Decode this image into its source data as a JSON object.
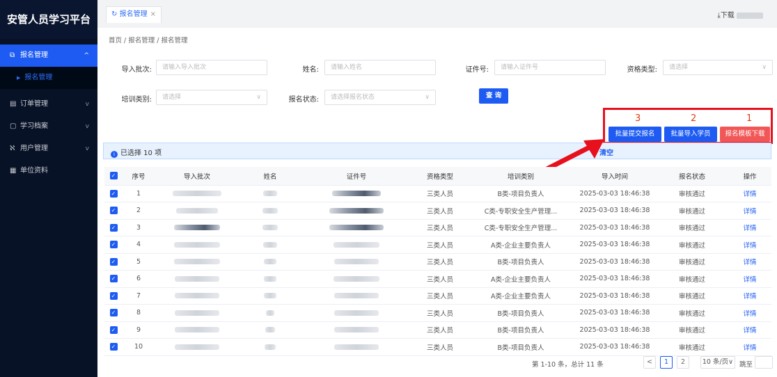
{
  "app_title": "安管人员学习平台",
  "sidebar": {
    "items": [
      {
        "label": "报名管理",
        "icon": "signup-icon",
        "chevron": "^"
      },
      {
        "label": "报名管理"
      },
      {
        "label": "订单管理",
        "icon": "order-icon",
        "chevron": "v"
      },
      {
        "label": "学习档案",
        "icon": "archive-icon",
        "chevron": "v"
      },
      {
        "label": "用户管理",
        "icon": "user-icon",
        "chevron": "v"
      },
      {
        "label": "单位资料",
        "icon": "unit-icon"
      }
    ]
  },
  "tab": {
    "label": "报名管理",
    "close": "×"
  },
  "download_label": "下载",
  "breadcrumb": "首页 / 报名管理 / 报名管理",
  "filters": {
    "batch_label": "导入批次:",
    "batch_placeholder": "请输入导入批次",
    "name_label": "姓名:",
    "name_placeholder": "请输入姓名",
    "id_label": "证件号:",
    "id_placeholder": "请输入证件号",
    "qual_label": "资格类型:",
    "qual_placeholder": "请选择",
    "train_label": "培训类别:",
    "train_placeholder": "请选择",
    "status_label": "报名状态:",
    "status_placeholder": "请选择报名状态",
    "query": "查 询"
  },
  "actions": {
    "batch_submit": "批量提交报名",
    "batch_import": "批量导入学员",
    "template_download": "报名模板下载",
    "num_submit": "3",
    "num_import": "2",
    "num_template": "1"
  },
  "selection": {
    "info": "已选择 10 项",
    "clear": "清空"
  },
  "table": {
    "headers": [
      "序号",
      "导入批次",
      "姓名",
      "证件号",
      "资格类型",
      "培训类别",
      "导入时间",
      "报名状态",
      "操作"
    ],
    "rows": [
      {
        "no": "1",
        "qual": "三类人员",
        "train": "B类-项目负责人",
        "time": "2025-03-03 18:46:38",
        "status": "审核通过",
        "op": "详情"
      },
      {
        "no": "2",
        "qual": "三类人员",
        "train": "C类-专职安全生产管理...",
        "time": "2025-03-03 18:46:38",
        "status": "审核通过",
        "op": "详情"
      },
      {
        "no": "3",
        "qual": "三类人员",
        "train": "C类-专职安全生产管理...",
        "time": "2025-03-03 18:46:38",
        "status": "审核通过",
        "op": "详情"
      },
      {
        "no": "4",
        "qual": "三类人员",
        "train": "A类-企业主要负责人",
        "time": "2025-03-03 18:46:38",
        "status": "审核通过",
        "op": "详情"
      },
      {
        "no": "5",
        "qual": "三类人员",
        "train": "B类-项目负责人",
        "time": "2025-03-03 18:46:38",
        "status": "审核通过",
        "op": "详情"
      },
      {
        "no": "6",
        "qual": "三类人员",
        "train": "A类-企业主要负责人",
        "time": "2025-03-03 18:46:38",
        "status": "审核通过",
        "op": "详情"
      },
      {
        "no": "7",
        "qual": "三类人员",
        "train": "A类-企业主要负责人",
        "time": "2025-03-03 18:46:38",
        "status": "审核通过",
        "op": "详情"
      },
      {
        "no": "8",
        "qual": "三类人员",
        "train": "B类-项目负责人",
        "time": "2025-03-03 18:46:38",
        "status": "审核通过",
        "op": "详情"
      },
      {
        "no": "9",
        "qual": "三类人员",
        "train": "B类-项目负责人",
        "time": "2025-03-03 18:46:38",
        "status": "审核通过",
        "op": "详情"
      },
      {
        "no": "10",
        "qual": "三类人员",
        "train": "B类-项目负责人",
        "time": "2025-03-03 18:46:38",
        "status": "审核通过",
        "op": "详情"
      }
    ]
  },
  "pagination": {
    "total_text": "第 1-10 条，总计 11 条",
    "prev": "<",
    "next": ">",
    "page1": "1",
    "page2": "2",
    "page_size": "10 条/页∨",
    "jump_label": "跳至"
  },
  "colors": {
    "primary": "#1d5bf2",
    "danger": "#f25757",
    "highlight": "#e8101d",
    "sidebar_bg": "#071226"
  }
}
